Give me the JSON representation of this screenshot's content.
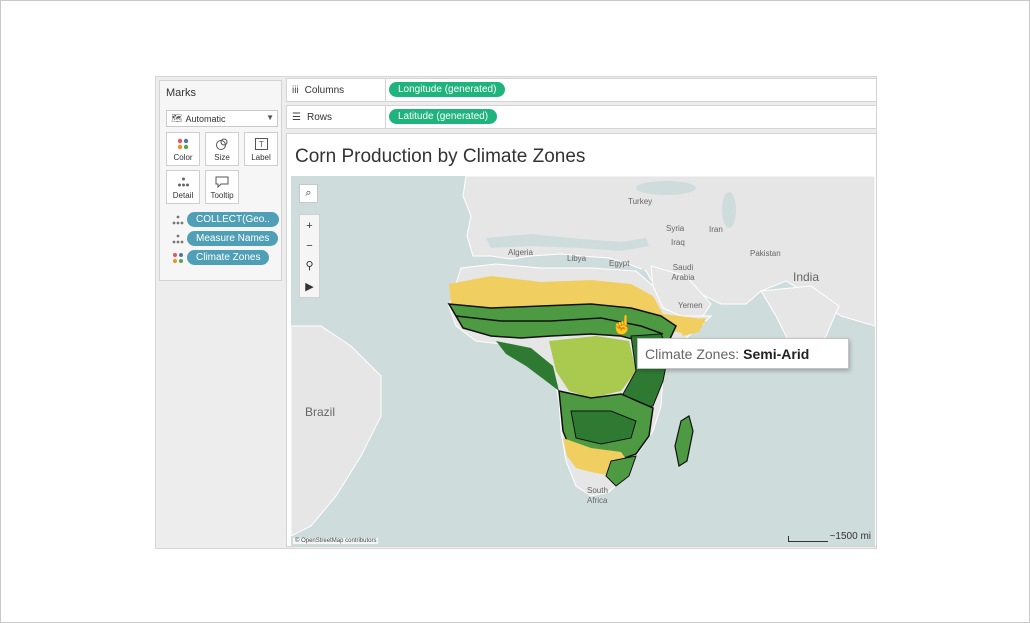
{
  "marks": {
    "title": "Marks",
    "mark_type": "Automatic",
    "buttons": {
      "color": "Color",
      "size": "Size",
      "label": "Label",
      "detail": "Detail",
      "tooltip": "Tooltip"
    },
    "pills": [
      "COLLECT(Geo..",
      "Measure Names",
      "Climate Zones"
    ]
  },
  "shelves": {
    "columns": {
      "label": "Columns",
      "pill": "Longitude (generated)"
    },
    "rows": {
      "label": "Rows",
      "pill": "Latitude (generated)"
    }
  },
  "sheet": {
    "title": "Corn Production by Climate Zones"
  },
  "map": {
    "countries": [
      "Turkey",
      "Syria",
      "Iraq",
      "Iran",
      "Algeria",
      "Libya",
      "Egypt",
      "Saudi Arabia",
      "Pakistan",
      "India",
      "Yemen",
      "Brazil",
      "South Africa"
    ],
    "attribution": "© OpenStreetMap contributors",
    "scale": "~1500 mi",
    "tooltip": {
      "field": "Climate Zones:",
      "value": "Semi-Arid"
    }
  },
  "colors": {
    "column_pill": "#1fb47e",
    "marks_pill": "#4f9fb6",
    "zone_arid": "#f0cf60",
    "zone_semi_arid": "#a9c94f",
    "zone_humid": "#4e9a43",
    "zone_tropical": "#2f7a33",
    "ocean": "#cfdcdc",
    "land": "#e6e6e6"
  }
}
